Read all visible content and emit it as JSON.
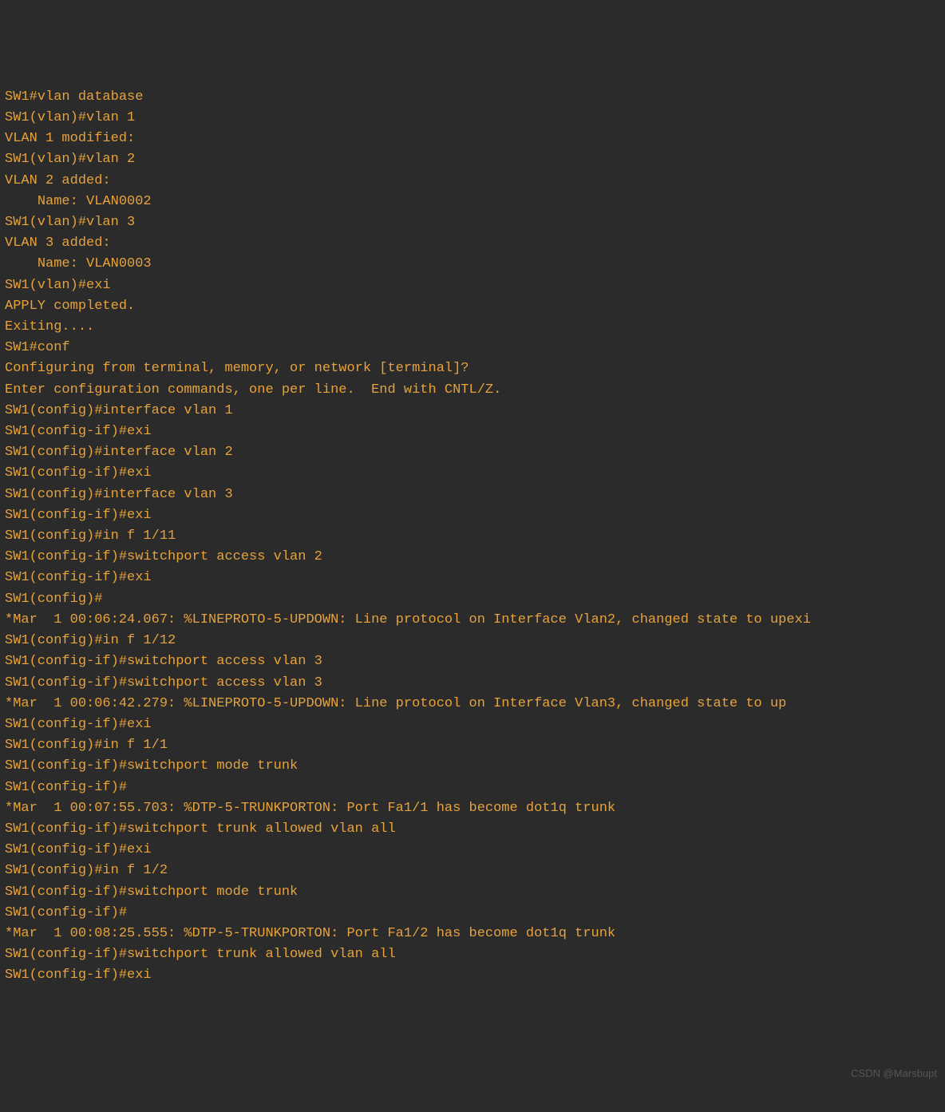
{
  "terminal": {
    "lines": [
      "SW1#vlan database",
      "SW1(vlan)#vlan 1",
      "VLAN 1 modified:",
      "SW1(vlan)#vlan 2",
      "VLAN 2 added:",
      "    Name: VLAN0002",
      "SW1(vlan)#vlan 3",
      "VLAN 3 added:",
      "    Name: VLAN0003",
      "SW1(vlan)#exi",
      "APPLY completed.",
      "Exiting....",
      "SW1#conf",
      "Configuring from terminal, memory, or network [terminal]?",
      "Enter configuration commands, one per line.  End with CNTL/Z.",
      "SW1(config)#interface vlan 1",
      "SW1(config-if)#exi",
      "SW1(config)#interface vlan 2",
      "SW1(config-if)#exi",
      "SW1(config)#interface vlan 3",
      "SW1(config-if)#exi",
      "SW1(config)#in f 1/11",
      "SW1(config-if)#switchport access vlan 2",
      "SW1(config-if)#exi",
      "SW1(config)#",
      "*Mar  1 00:06:24.067: %LINEPROTO-5-UPDOWN: Line protocol on Interface Vlan2, changed state to upexi",
      "SW1(config)#in f 1/12",
      "SW1(config-if)#switchport access vlan 3",
      "SW1(config-if)#switchport access vlan 3",
      "*Mar  1 00:06:42.279: %LINEPROTO-5-UPDOWN: Line protocol on Interface Vlan3, changed state to up",
      "SW1(config-if)#exi",
      "SW1(config)#in f 1/1",
      "SW1(config-if)#switchport mode trunk",
      "SW1(config-if)#",
      "*Mar  1 00:07:55.703: %DTP-5-TRUNKPORTON: Port Fa1/1 has become dot1q trunk",
      "SW1(config-if)#switchport trunk allowed vlan all",
      "SW1(config-if)#exi",
      "SW1(config)#in f 1/2",
      "SW1(config-if)#switchport mode trunk",
      "SW1(config-if)#",
      "*Mar  1 00:08:25.555: %DTP-5-TRUNKPORTON: Port Fa1/2 has become dot1q trunk",
      "SW1(config-if)#switchport trunk allowed vlan all",
      "SW1(config-if)#exi"
    ]
  },
  "watermark": "CSDN @Marsbupt"
}
